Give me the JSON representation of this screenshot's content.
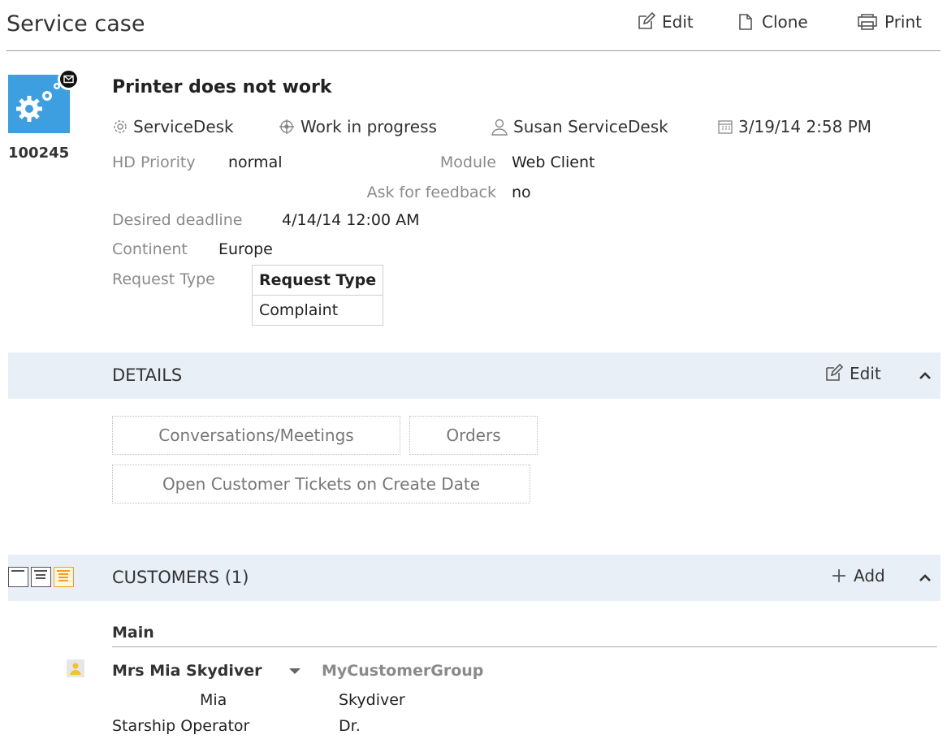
{
  "header": {
    "title": "Service case",
    "edit_label": "Edit",
    "clone_label": "Clone",
    "print_label": "Print"
  },
  "case": {
    "id": "100245",
    "title": "Printer does not work",
    "tile_color": "#3d9fe0",
    "meta": {
      "desk": "ServiceDesk",
      "status": "Work in progress",
      "assignee": "Susan ServiceDesk",
      "datetime": "3/19/14 2:58 PM"
    },
    "fields": {
      "hd_priority_label": "HD Priority",
      "hd_priority_value": "normal",
      "module_label": "Module",
      "module_value": "Web Client",
      "ask_feedback_label": "Ask for feedback",
      "ask_feedback_value": "no",
      "deadline_label": "Desired deadline",
      "deadline_value": "4/14/14 12:00 AM",
      "continent_label": "Continent",
      "continent_value": "Europe",
      "request_type_label": "Request Type",
      "request_type_header": "Request Type",
      "request_type_value": "Complaint"
    }
  },
  "details": {
    "label": "DETAILS",
    "edit_label": "Edit",
    "buttons": [
      "Conversations/Meetings",
      "Orders",
      "Open Customer Tickets on Create Date"
    ]
  },
  "customers": {
    "label": "CUSTOMERS (1)",
    "add_label": "Add",
    "group_label": "Main",
    "customer": {
      "name": "Mrs Mia Skydiver",
      "group": "MyCustomerGroup",
      "first_name": "Mia",
      "last_name": "Skydiver",
      "job": "Starship Operator",
      "title": "Dr."
    }
  },
  "colors": {
    "section_bg": "#e9eff7",
    "accent_blue": "#3d9fe0",
    "view_active": "#f0a020"
  }
}
